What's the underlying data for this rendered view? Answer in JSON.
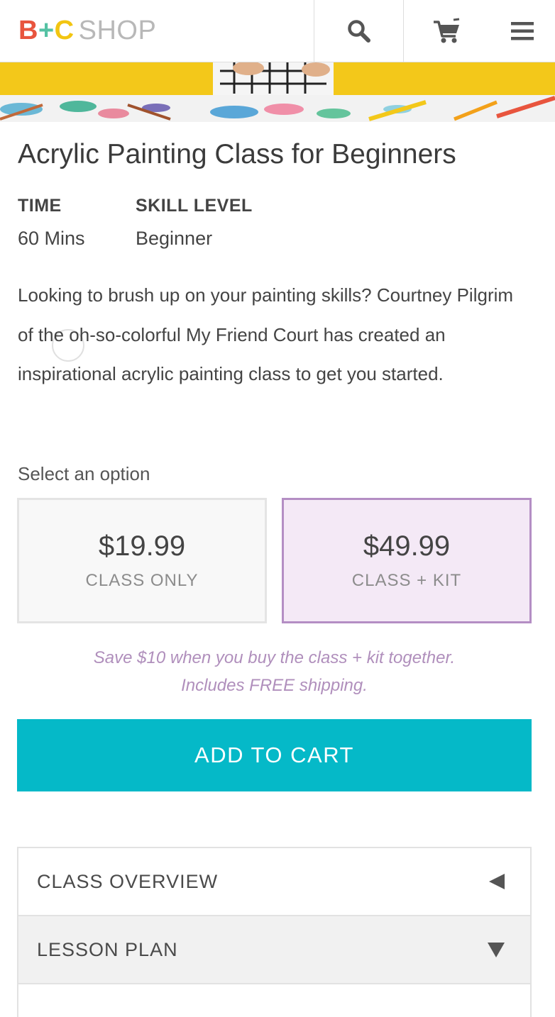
{
  "header": {
    "logo": {
      "b": "B",
      "plus": "+",
      "c": "C",
      "shop": "SHOP"
    },
    "search_icon": "search-icon",
    "cart_icon": "cart-icon",
    "menu_icon": "menu-icon"
  },
  "course": {
    "title": "Acrylic Painting Class for Beginners",
    "time_label": "TIME",
    "time_value": "60 Mins",
    "skill_label": "SKILL LEVEL",
    "skill_value": "Beginner",
    "description": "Looking to brush up on your painting skills? Courtney Pilgrim of the oh-so-colorful My Friend Court has created an inspirational acrylic painting class to get you started."
  },
  "purchase": {
    "select_label": "Select an option",
    "options": [
      {
        "price": "$19.99",
        "name": "CLASS ONLY",
        "selected": false
      },
      {
        "price": "$49.99",
        "name": "CLASS + KIT",
        "selected": true
      }
    ],
    "promo_line1": "Save $10 when you buy the class + kit together.",
    "promo_line2": "Includes FREE shipping.",
    "add_to_cart": "ADD TO CART"
  },
  "accordion": [
    {
      "label": "CLASS OVERVIEW",
      "icon": "triangle-left-icon"
    },
    {
      "label": "LESSON PLAN",
      "icon": "triangle-down-icon"
    }
  ],
  "colors": {
    "brand_red": "#e8553e",
    "brand_green": "#55c2a4",
    "brand_yellow": "#f2c511",
    "accent_teal": "#05b9c8",
    "selected_purple": "#b48ec4",
    "promo_purple": "#b08fbc"
  }
}
